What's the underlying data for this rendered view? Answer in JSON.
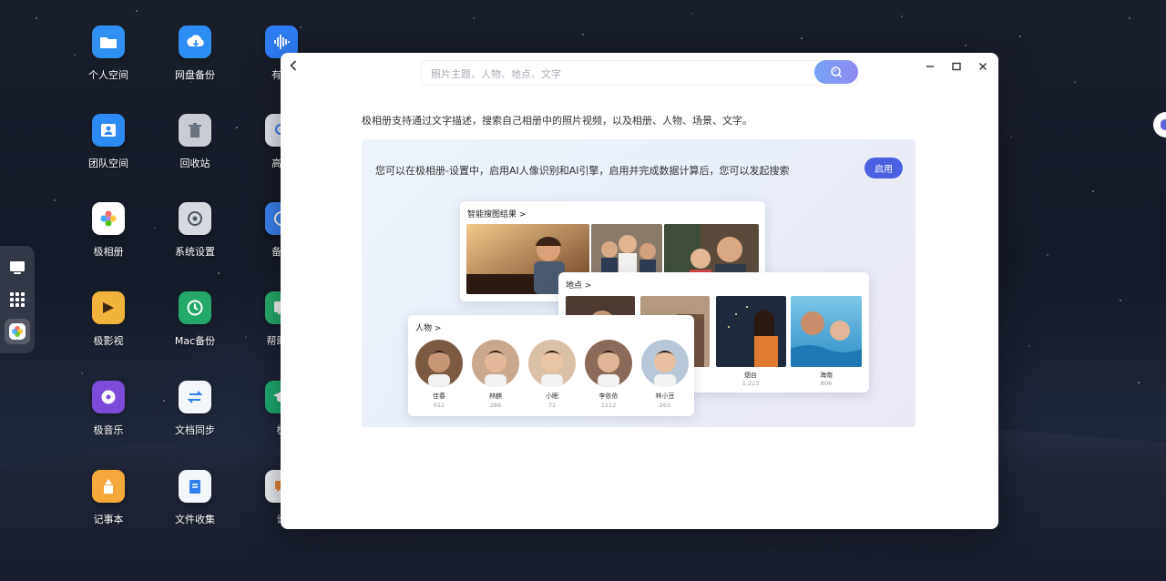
{
  "desktop": {
    "icons": [
      {
        "label": "个人空间",
        "icon": "folder-icon",
        "color": "#2f8ff3"
      },
      {
        "label": "网盘备份",
        "icon": "cloud-download-icon",
        "color": "#2d8df2"
      },
      {
        "label": "有声",
        "icon": "audio-wave-icon",
        "color": "#2f7df5"
      },
      {
        "label": "团队空间",
        "icon": "team-icon",
        "color": "#2e8af3"
      },
      {
        "label": "回收站",
        "icon": "trash-icon",
        "color": "#c9ccd2"
      },
      {
        "label": "高级",
        "icon": "search-circle-icon",
        "color": "#e8ecf3"
      },
      {
        "label": "极相册",
        "icon": "flower-icon",
        "color": "#ffffff"
      },
      {
        "label": "系统设置",
        "icon": "gear-icon",
        "color": "#d6d9df"
      },
      {
        "label": "备份",
        "icon": "backup-icon",
        "color": "#3b86f5"
      },
      {
        "label": "极影视",
        "icon": "film-icon",
        "color": "#f2b33a"
      },
      {
        "label": "Mac备份",
        "icon": "clock-icon",
        "color": "#25a96a"
      },
      {
        "label": "帮助与",
        "icon": "help-icon",
        "color": "#29b06f"
      },
      {
        "label": "极音乐",
        "icon": "music-disc-icon",
        "color": "#7c4bd8"
      },
      {
        "label": "文档同步",
        "icon": "sync-icon",
        "color": "#f3f6fa"
      },
      {
        "label": "极",
        "icon": "graduation-icon",
        "color": "#1fae72"
      },
      {
        "label": "记事本",
        "icon": "notebook-icon",
        "color": "#f6a93b"
      },
      {
        "label": "文件收集",
        "icon": "file-collect-icon",
        "color": "#f3f6fa"
      },
      {
        "label": "论",
        "icon": "chat-icon",
        "color": "#f3f6fa"
      }
    ]
  },
  "dock": {
    "items": [
      {
        "icon": "monitor-icon"
      },
      {
        "icon": "grid-icon"
      },
      {
        "icon": "photos-app-icon",
        "active": true
      }
    ]
  },
  "window": {
    "search": {
      "placeholder": "照片主题、人物、地点、文字"
    },
    "intro": "极相册支持通过文字描述，搜索自己相册中的照片视频，以及相册、人物、场景、文字。",
    "panel": {
      "text": "您可以在极相册-设置中，启用AI人像识别和AI引擎，启用并完成数据计算后，您可以发起搜索",
      "enable_label": "启用"
    },
    "cards": {
      "smart": {
        "title": "智能搜图结果 >"
      },
      "places": {
        "title": "地点 >",
        "items": [
          {
            "name": "烟台",
            "count": "1,213"
          },
          {
            "name": "海南",
            "count": "806"
          }
        ]
      },
      "people": {
        "title": "人物 >",
        "items": [
          {
            "name": "佳春",
            "count": "912"
          },
          {
            "name": "林麒",
            "count": "288"
          },
          {
            "name": "小眠",
            "count": "71"
          },
          {
            "name": "李依依",
            "count": "1212"
          },
          {
            "name": "林小豆",
            "count": "263"
          }
        ]
      }
    }
  }
}
